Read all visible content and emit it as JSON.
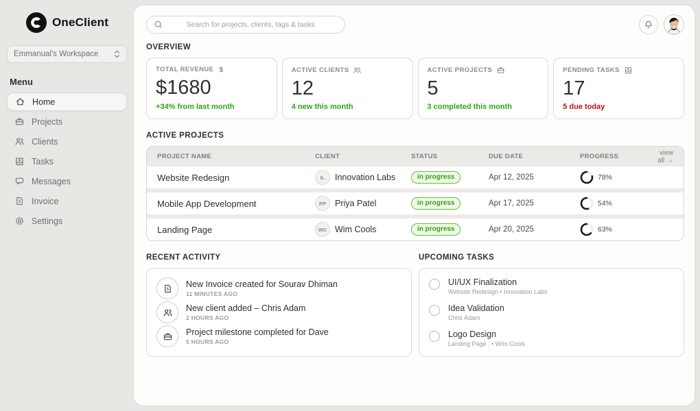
{
  "app": {
    "name": "OneClient"
  },
  "colors": {
    "green": "#2fa318",
    "red": "#b41217",
    "badge_text": "#3a9c16",
    "badge_bg": "#eefae6"
  },
  "sidebar": {
    "workspace": "Emmanual's Workspace",
    "menu_label": "Menu",
    "items": [
      {
        "label": "Home"
      },
      {
        "label": "Projects"
      },
      {
        "label": "Clients"
      },
      {
        "label": "Tasks"
      },
      {
        "label": "Messages"
      },
      {
        "label": "Invoice"
      },
      {
        "label": "Settings"
      }
    ]
  },
  "topbar": {
    "search_placeholder": "Search for projects, clients, tags & tasks"
  },
  "overview": {
    "title": "OVERVIEW",
    "cards": [
      {
        "label": "TOTAL REVENUE",
        "icon": "dollar-icon",
        "value": "$1680",
        "note": "+34% from last month"
      },
      {
        "label": "ACTIVE CLIENTS",
        "icon": "users-icon",
        "value": "12",
        "note": "4 new this month"
      },
      {
        "label": "ACTIVE PROJECTS",
        "icon": "briefcase-icon",
        "value": "5",
        "note": "3 completed this month"
      },
      {
        "label": "PENDING TASKS",
        "icon": "tray-icon",
        "value": "17",
        "note": "5 due today"
      }
    ]
  },
  "projects": {
    "title": "ACTIVE PROJECTS",
    "columns": [
      "PROJECT NAME",
      "CLIENT",
      "STATUS",
      "DUE DATE",
      "PROGRESS"
    ],
    "view_all": "view all →",
    "rows": [
      {
        "name": "Website Redesign",
        "client_initials": "IL",
        "client": "Innovation Labs",
        "status": "in progress",
        "due": "Apr 12, 2025",
        "progress": 78,
        "progress_label": "78%"
      },
      {
        "name": "Mobile App Development",
        "client_initials": "PP",
        "client": "Priya Patel",
        "status": "in progress",
        "due": "Apr 17, 2025",
        "progress": 54,
        "progress_label": "54%"
      },
      {
        "name": "Landing Page",
        "client_initials": "WC",
        "client": "Wim Cools",
        "status": "in progress",
        "due": "Apr 20, 2025",
        "progress": 63,
        "progress_label": "63%"
      }
    ]
  },
  "activity": {
    "title": "RECENT ACTIVITY",
    "items": [
      {
        "icon": "invoice-icon",
        "text": "New Invoice created for Sourav Dhiman",
        "time": "11 MINUTES AGO"
      },
      {
        "icon": "users-icon",
        "text": "New client added – Chris Adam",
        "time": "2 HOURS AGO"
      },
      {
        "icon": "briefcase-icon",
        "text": "Project milestone completed for Dave",
        "time": "5 HOURS AGO"
      }
    ]
  },
  "tasks": {
    "title": "UPCOMING TASKS",
    "items": [
      {
        "title": "UI/UX Finalization",
        "meta": "Website Redesign  •  Innovation Labs"
      },
      {
        "title": "Idea Validation",
        "meta": "Chris Adam"
      },
      {
        "title": "Logo Design",
        "meta": "Landing Page .  •  Wim Cools"
      }
    ]
  }
}
